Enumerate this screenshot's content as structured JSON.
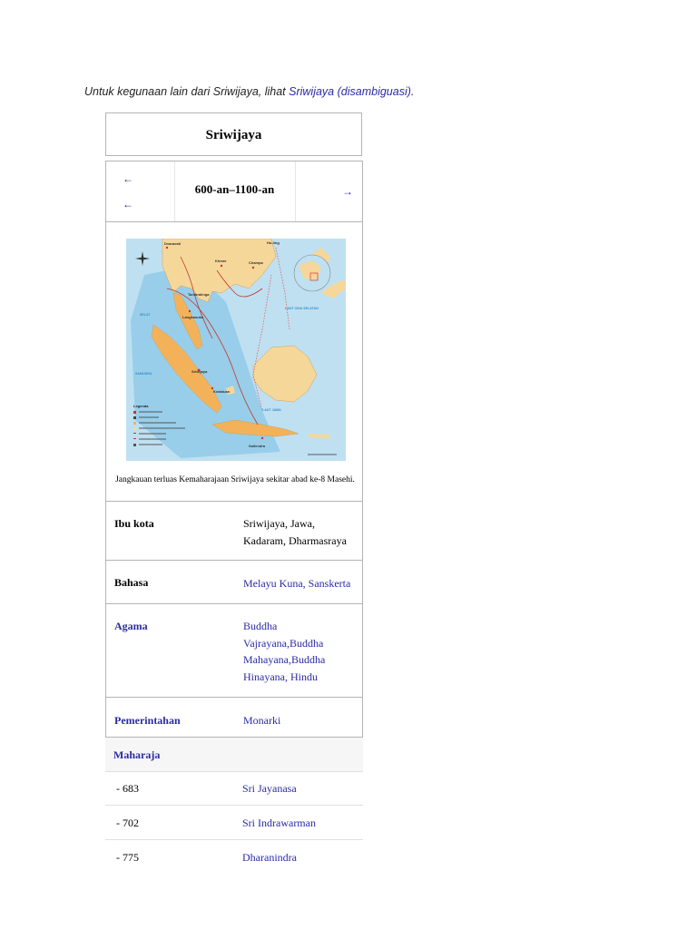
{
  "hatnote": {
    "prefix": "Untuk kegunaan lain dari Sriwijaya, lihat ",
    "link": "Sriwijaya (disambiguasi)",
    "suffix": "."
  },
  "infobox": {
    "title": "Sriwijaya",
    "period": "600-an–1100-an",
    "prev_arrow_1": "←",
    "prev_arrow_2": "←",
    "next_arrow": "→",
    "map_caption": "Jangkauan terluas Kemaharajaan Sriwijaya sekitar abad ke-8 Masehi.",
    "map_legend_title": "Legenda",
    "rows": [
      {
        "key": "Ibu kota",
        "value_lines": [
          "Sriwijaya, Jawa,",
          "Kadaram, Dharmasraya"
        ]
      },
      {
        "key": "Bahasa",
        "value_lines": [
          "Melayu Kuna, Sanskerta"
        ]
      },
      {
        "key": "Agama",
        "value_lines": [
          "Buddha",
          "Vajrayana,Buddha",
          "Mahayana,Buddha",
          "Hinayana, Hindu"
        ]
      },
      {
        "key": "Pemerintahan",
        "value_lines": [
          "Monarki"
        ]
      }
    ],
    "rulers_heading": "Maharaja",
    "rulers": [
      {
        "year": " - 683",
        "name": "Sri Jayanasa"
      },
      {
        "year": " - 702",
        "name": "Sri Indrawarman"
      },
      {
        "year": " - 775",
        "name": "Dharanindra"
      }
    ]
  },
  "colors": {
    "link": "#2a2aa5",
    "border": "#b4b4b4",
    "sea": "#bfe0f1",
    "land": "#f6d79a",
    "empire": "#f3b25a"
  }
}
